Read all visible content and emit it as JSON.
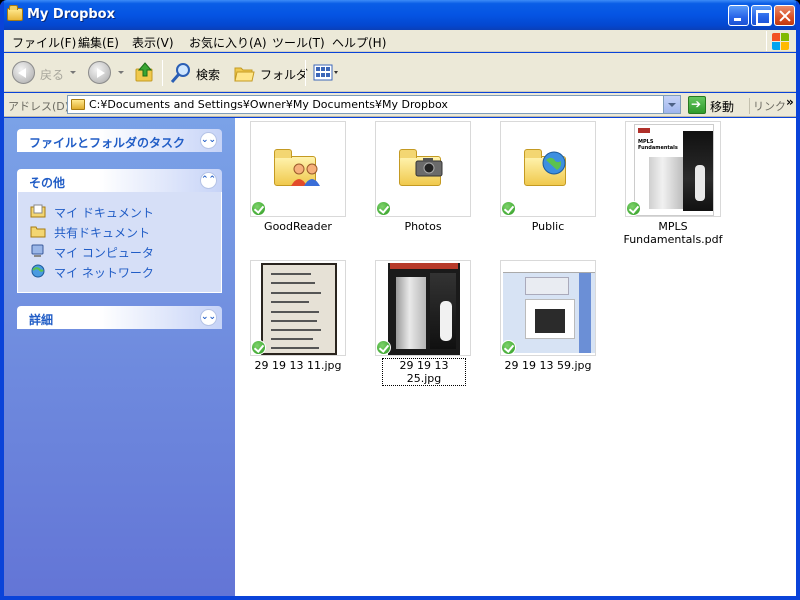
{
  "window": {
    "title": "My Dropbox",
    "title_icon": "folder-icon"
  },
  "menu": [
    "ファイル(F)",
    "編集(E)",
    "表示(V)",
    "お気に入り(A)",
    "ツール(T)",
    "ヘルプ(H)"
  ],
  "toolbar": {
    "back_label": "戻る",
    "search_label": "検索",
    "folders_label": "フォルダ"
  },
  "address": {
    "label": "アドレス(D)",
    "path": "C:¥Documents and Settings¥Owner¥My Documents¥My Dropbox",
    "go_label": "移動",
    "links_label": "リンク"
  },
  "taskpane": {
    "panels": [
      {
        "title": "ファイルとフォルダのタスク",
        "expanded": false
      },
      {
        "title": "その他",
        "expanded": true,
        "links": [
          {
            "label": "マイ ドキュメント",
            "icon": "my-documents-icon"
          },
          {
            "label": "共有ドキュメント",
            "icon": "shared-documents-folder-icon"
          },
          {
            "label": "マイ コンピュータ",
            "icon": "my-computer-icon"
          },
          {
            "label": "マイ ネットワーク",
            "icon": "my-network-icon"
          }
        ]
      },
      {
        "title": "詳細",
        "expanded": false
      }
    ]
  },
  "files": [
    {
      "name": "GoodReader",
      "type": "folder",
      "synced": true
    },
    {
      "name": "Photos",
      "type": "folder",
      "synced": true
    },
    {
      "name": "Public",
      "type": "folder",
      "synced": true
    },
    {
      "name": "MPLS Fundamentals.pdf",
      "type": "pdf",
      "synced": true,
      "thumb_title": "MPLS Fundamentals"
    },
    {
      "name": "29 19 13 11.jpg",
      "type": "jpg",
      "synced": true
    },
    {
      "name": "29 19 13 25.jpg",
      "type": "jpg",
      "synced": true,
      "selected": true
    },
    {
      "name": "29 19 13 59.jpg",
      "type": "jpg",
      "synced": true
    }
  ],
  "colors": {
    "title_blue": "#0554e3",
    "task_link": "#215dc6",
    "sync_green": "#2a9a1f"
  }
}
